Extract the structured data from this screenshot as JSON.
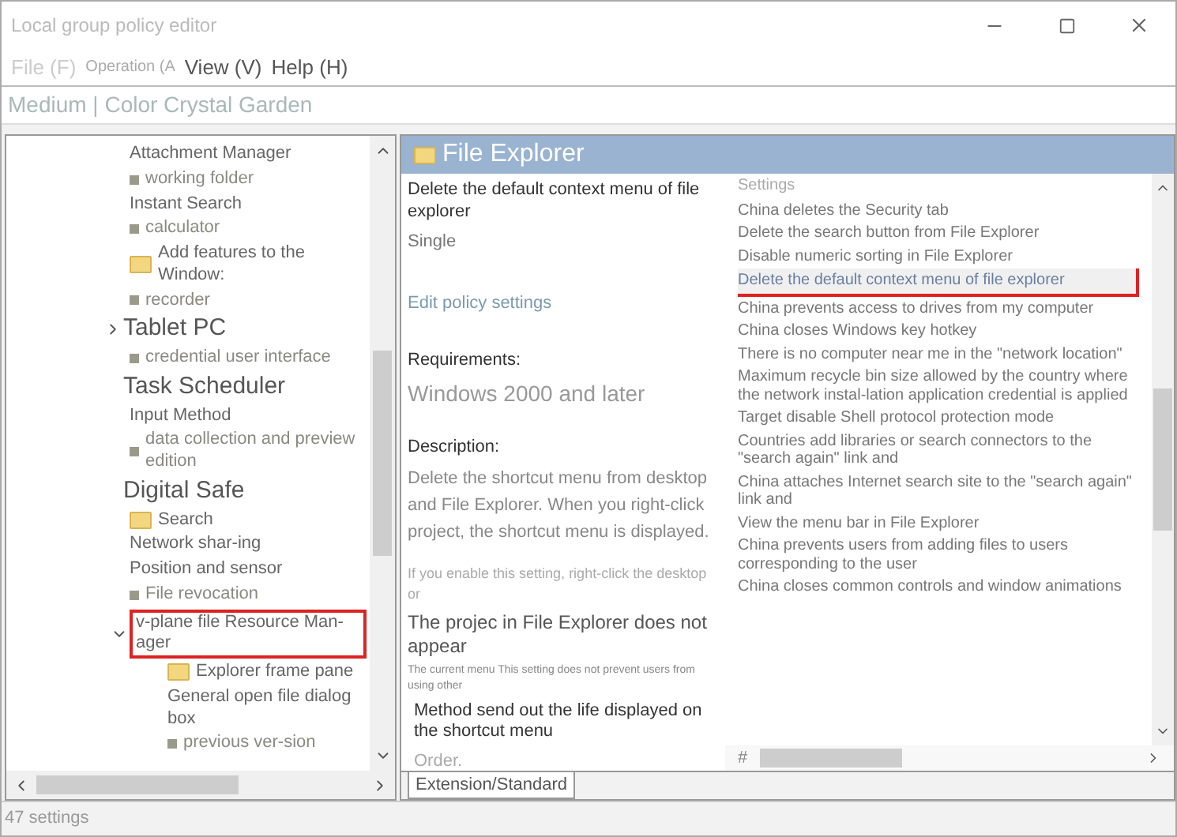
{
  "window": {
    "title": "Local group policy editor"
  },
  "menu": [
    {
      "label": "File (F)"
    },
    {
      "label": "Operation (A"
    },
    {
      "label": "View (V)"
    },
    {
      "label": "Help (H)"
    }
  ],
  "address": "Medium | Color Crystal Garden",
  "tree": [
    {
      "label": "Attachment Manager",
      "kind": "plain",
      "selected": false
    },
    {
      "label": "working folder",
      "kind": "bullet",
      "selected": false
    },
    {
      "label": "Instant Search",
      "kind": "plain",
      "selected": false
    },
    {
      "label": "calculator",
      "kind": "bullet",
      "selected": false
    },
    {
      "label": "Add features to the Window:",
      "kind": "folder",
      "selected": false
    },
    {
      "label": "recorder",
      "kind": "bullet",
      "selected": false
    },
    {
      "label": "Tablet PC",
      "kind": "heading",
      "expanded": false,
      "selected": false
    },
    {
      "label": "credential user interface",
      "kind": "bullet",
      "selected": false
    },
    {
      "label": "Task Scheduler",
      "kind": "heading",
      "selected": false
    },
    {
      "label": "Input Method",
      "kind": "plain",
      "selected": false
    },
    {
      "label": "data collection and preview edition",
      "kind": "bullet",
      "selected": false
    },
    {
      "label": "Digital Safe",
      "kind": "heading",
      "selected": false
    },
    {
      "label": "Search",
      "kind": "folder",
      "selected": false
    },
    {
      "label": "Network shar-ing",
      "kind": "plain",
      "selected": false
    },
    {
      "label": "Position and sensor",
      "kind": "plain",
      "selected": false
    },
    {
      "label": "File revocation",
      "kind": "bullet",
      "selected": false
    },
    {
      "label": "v-plane file Resource Man-ager",
      "kind": "plain",
      "expanded": true,
      "selected": true,
      "children": [
        {
          "label": "Explorer frame pane",
          "kind": "folder",
          "selected": false
        },
        {
          "label": "General open file dialog box",
          "kind": "plain",
          "selected": false
        },
        {
          "label": "previous ver-sion",
          "kind": "bullet",
          "selected": false
        }
      ]
    }
  ],
  "header": "File Explorer",
  "detail": {
    "title": "Delete the default context menu of file explorer",
    "mode": "Single",
    "link": "Edit policy settings",
    "requirements_label": "Requirements:",
    "requirements": "Windows 2000 and later",
    "description_label": "Description:",
    "description": "Delete the shortcut menu from desktop and File Explorer. When you right-click project, the shortcut menu is displayed.",
    "note_1": "If you enable this setting, right-click the desktop or",
    "note_2": "The projec in File Explorer does not appear",
    "note_3": "The current menu This setting does not prevent users from using other",
    "note_4": "Method send out the life displayed on the shortcut menu",
    "note_5": "Order."
  },
  "settings_header": "Settings",
  "settings": [
    {
      "label": "China deletes the Security tab",
      "selected": false
    },
    {
      "label": "Delete the search button from File Explorer",
      "selected": false
    },
    {
      "label": "Disable numeric sorting in File Explorer",
      "selected": false
    },
    {
      "label": "Delete the default context menu of file explorer",
      "selected": true
    },
    {
      "label": "China prevents access to drives from my computer",
      "selected": false
    },
    {
      "label": "China closes Windows key hotkey",
      "selected": false
    },
    {
      "label": "There is no computer near me in the \"network location\"",
      "selected": false
    },
    {
      "label": "Maximum recycle bin size allowed by the country where the network instal-lation application credential is applied",
      "selected": false
    },
    {
      "label": "Target disable Shell protocol protection mode",
      "selected": false
    },
    {
      "label": "Countries add libraries or search connectors to the \"search again\" link and",
      "selected": false
    },
    {
      "label": "China attaches Internet search site to the \"search again\" link and",
      "selected": false
    },
    {
      "label": "View the menu bar in File Explorer",
      "selected": false
    },
    {
      "label": "China prevents users from adding files to users corresponding to the user",
      "selected": false
    },
    {
      "label": "China closes common controls and window animations",
      "selected": false
    }
  ],
  "column_hint": "#",
  "tabs": [
    {
      "label": "Extension/Standard",
      "selected": true
    }
  ],
  "status_bar": "47 settings"
}
